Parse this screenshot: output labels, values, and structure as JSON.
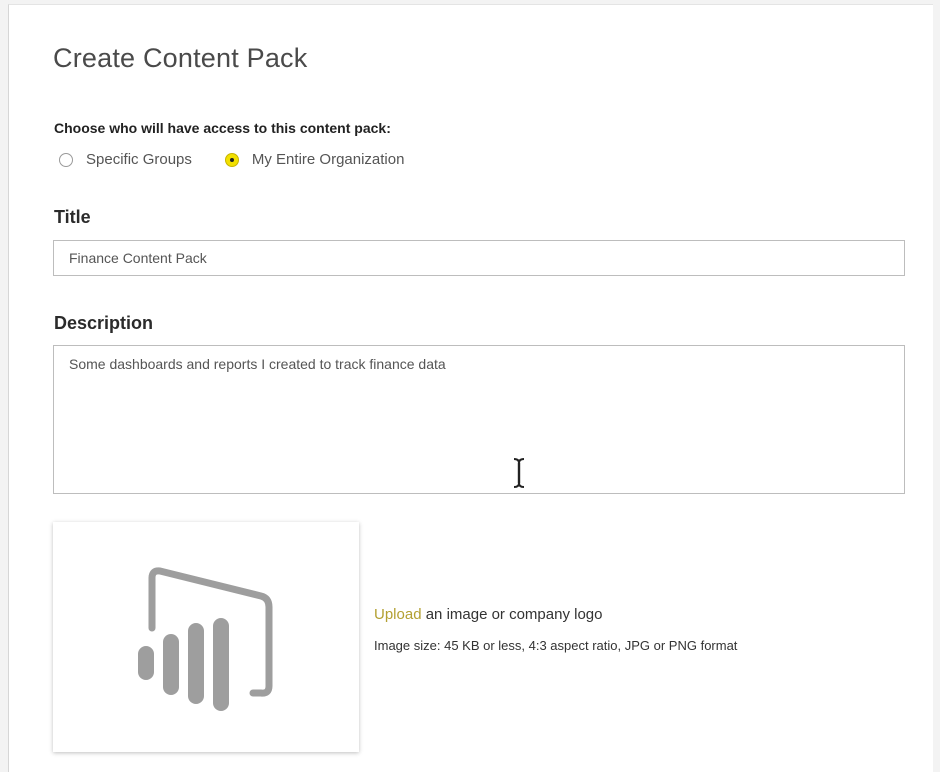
{
  "dialog": {
    "title": "Create Content Pack",
    "access_label": "Choose who will have access to this content pack:",
    "access_options": [
      {
        "label": "Specific Groups",
        "selected": false
      },
      {
        "label": "My Entire Organization",
        "selected": true
      }
    ]
  },
  "form": {
    "title_label": "Title",
    "title_value": "Finance Content Pack",
    "description_label": "Description",
    "description_value": "Some dashboards and reports I created to track finance data"
  },
  "image": {
    "logo_icon": "power-bi-logo-icon",
    "upload_link": "Upload",
    "upload_text": " an image or company logo",
    "size_note": "Image size: 45 KB or less, 4:3 aspect ratio, JPG or PNG format"
  },
  "colors": {
    "radio_selected": "#f2e000",
    "upload_link": "#b3a032",
    "logo_gray": "#9e9e9e"
  }
}
